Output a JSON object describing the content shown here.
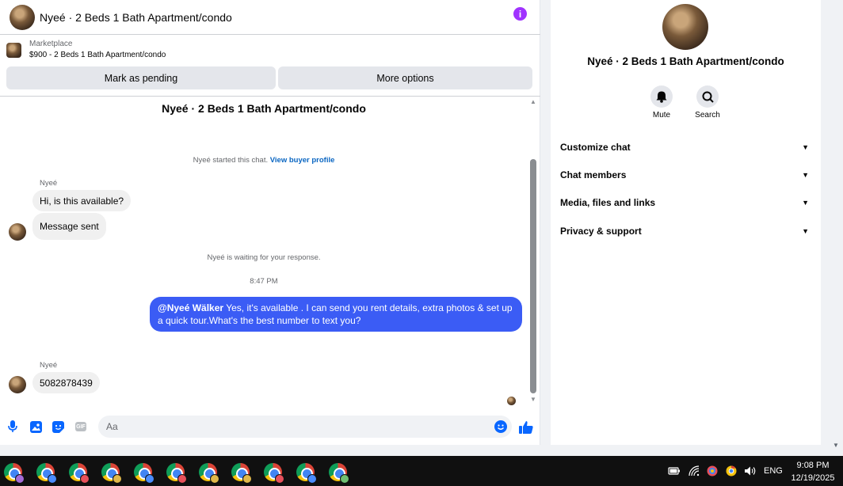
{
  "chat": {
    "title": "Nyeé · 2 Beds 1 Bath Apartment/condo",
    "listing_label": "Marketplace",
    "listing_price": "$900 - 2 Beds 1 Bath Apartment/condo",
    "btn_pending": "Mark as pending",
    "btn_more": "More options",
    "thread_title": "Nyeé · 2 Beds 1 Bath Apartment/condo",
    "started_text": "Nyeé started this chat.",
    "buyer_profile_link": "View buyer profile",
    "sender_name": "Nyeé",
    "msg1": "Hi, is this available?",
    "msg2": "Message sent",
    "waiting_text": "Nyeé is waiting for your response.",
    "timestamp": "8:47 PM",
    "reply_mention": "@Nyeé Wälker",
    "reply_text": " Yes, it's available .  I can send you rent details, extra photos & set up a quick tour.What's the best number to text you?",
    "sender_name_2": "Nyeé",
    "msg3": "5082878439",
    "composer_placeholder": "Aa"
  },
  "info": {
    "name": "Nyeé · 2 Beds 1 Bath Apartment/condo",
    "mute_label": "Mute",
    "search_label": "Search",
    "sections": [
      "Customize chat",
      "Chat members",
      "Media, files and links",
      "Privacy & support"
    ]
  },
  "taskbar": {
    "language": "ENG",
    "time": "9:08 PM",
    "date": "12/19/2025",
    "profile_badges": [
      "#a56bd8",
      "#4a8cff",
      "#e8505b",
      "#e0b84a",
      "#4a8cff",
      "#e8505b",
      "#e0b84a",
      "#e0b84a",
      "#e8505b",
      "#4a8cff",
      "#6fbf73"
    ]
  },
  "colors": {
    "accent_blue": "#3b5cf5",
    "info_purple": "#a033ff",
    "like_blue": "#0866ff"
  }
}
